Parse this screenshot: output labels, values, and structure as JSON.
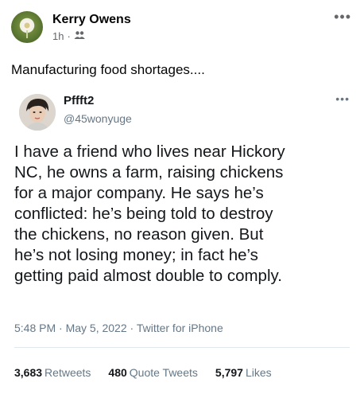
{
  "facebook_post": {
    "author": "Kerry Owens",
    "time": "1h",
    "separator": "·",
    "caption": "Manufacturing food shortages....",
    "more_icon": "more-horizontal-icon",
    "audience_icon": "friends-icon"
  },
  "tweet": {
    "display_name": "Pffft2",
    "handle": "@45wonyuge",
    "body_lines": [
      "I have a friend who lives near Hickory",
      "NC, he owns a farm, raising chickens",
      "for a major company. He says he’s",
      "conflicted: he’s being told to destroy",
      "the chickens, no reason given. But",
      "he’s not losing money; in fact he’s",
      "getting paid almost double to comply."
    ],
    "footer": "5:48 PM · May 5, 2022 · Twitter for iPhone",
    "stats": {
      "retweets_count": "3,683",
      "retweets_label": "Retweets",
      "quote_count": "480",
      "quote_label": "Quote Tweets",
      "likes_count": "5,797",
      "likes_label": "Likes"
    }
  }
}
